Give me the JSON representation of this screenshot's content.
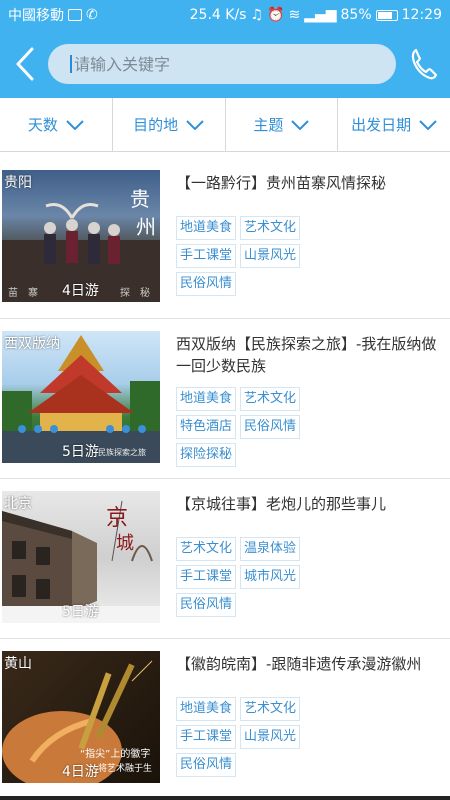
{
  "status_bar": {
    "carrier": "中國移動",
    "speed": "25.4 K/s",
    "battery": "85%",
    "time": "12:29"
  },
  "search": {
    "placeholder": "请输入关键字"
  },
  "filters": [
    {
      "label": "天数"
    },
    {
      "label": "目的地"
    },
    {
      "label": "主题"
    },
    {
      "label": "出发日期"
    }
  ],
  "items": [
    {
      "location": "贵阳",
      "days": "4日游",
      "title": "【一路黔行】贵州苗寨风情探秘",
      "tags": [
        "地道美食",
        "艺术文化",
        "手工课堂",
        "山景风光",
        "民俗风情"
      ],
      "overlay_text": "贵州"
    },
    {
      "location": "西双版纳",
      "days": "5日游",
      "title": "西双版纳【民族探索之旅】-我在版纳做一回少数民族",
      "tags": [
        "地道美食",
        "艺术文化",
        "特色酒店",
        "民俗风情",
        "探险探秘"
      ],
      "overlay_text": "西双版纳"
    },
    {
      "location": "北京",
      "days": "5日游",
      "title": "【京城往事】老炮儿的那些事儿",
      "tags": [
        "艺术文化",
        "温泉体验",
        "手工课堂",
        "城市风光",
        "民俗风情"
      ],
      "overlay_text": "京城"
    },
    {
      "location": "黄山",
      "days": "4日游",
      "title": "【徽韵皖南】-跟随非遗传承漫游徽州",
      "tags": [
        "地道美食",
        "艺术文化",
        "手工课堂",
        "山景风光",
        "民俗风情"
      ],
      "overlay_text": "“指尖”上的徽字"
    }
  ],
  "colors": {
    "accent": "#41b2f0",
    "filter_text": "#2f8fd8",
    "tag_text": "#3a8fd0"
  }
}
